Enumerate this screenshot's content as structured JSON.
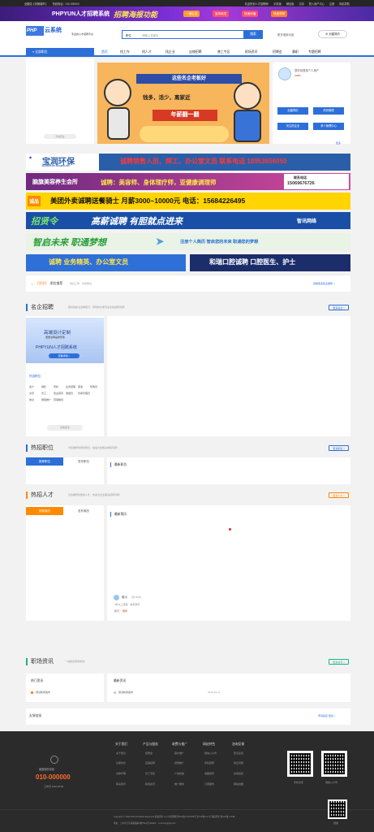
{
  "topbar": {
    "location": "全国站【切换城市】",
    "phone": "热线电话：010-000000",
    "welcome": "欢迎来到人才招聘网!",
    "mobile": "手机版",
    "wechat": "微信版",
    "app_link": "订阅",
    "login": "登入用户中心",
    "register": "注册",
    "nav_link": "网站导航"
  },
  "banner": {
    "brand": "PHPYUN人才招聘系统",
    "headline": "招聘海报功能",
    "pill1": "一键生成",
    "pill2": "宣传转发",
    "pill3": "快速传播",
    "pill4": "快速求职"
  },
  "header": {
    "logo": "PHP",
    "logo_suffix": "云系统",
    "tagline": "专业的人才招聘平台",
    "search_category": "职位",
    "search_placeholder": "请输入关键字",
    "search_button": "搜索",
    "more_search": "更多搜索功能",
    "create_resume": "创建简历"
  },
  "nav": {
    "category_label": "全部职位",
    "items": [
      "首页",
      "找工作",
      "找人才",
      "找企业",
      "店铺招聘",
      "普工专区",
      "职场资讯",
      "招聘会",
      "兼职",
      "专题招聘"
    ]
  },
  "sidebar": {
    "page_label": "查看更多"
  },
  "cartoon": {
    "line1": "这些名企老板好",
    "line2": "钱多，活少，离家近",
    "line3": "年薪翻一翻"
  },
  "user": {
    "greeting": "您好!",
    "sub": "请登录个人用户",
    "name": "uoshi",
    "btn_create": "创建简历",
    "btn_jobs": "简历管理",
    "btn_company": "关注的企业",
    "btn_apply": "求人管理中心",
    "more": "更多"
  },
  "ads": [
    {
      "brand": "宝润环保",
      "brand_en": "BAORUN EP-TECHNOLOGY",
      "text": "诚聘销售人员、焊工、办公室文员 联系电话 18953656050"
    },
    {
      "brand": "脑旗美容养生会所",
      "text": "诚聘：美容师、身体理疗师，亚健康调理师",
      "contact": "联系电话",
      "phone": "15069676726"
    },
    {
      "brand": "诚品",
      "text": "美团外卖诚聘送餐骑士 月薪3000~10000元 电话：15684226495"
    },
    {
      "brand": "招贤令",
      "text": "高薪诚聘  有胆就点进来",
      "logo": "智讯网络"
    },
    {
      "brand": "智启未来 职通梦想",
      "text": "注册个人简历 智启您的未来 职通您的梦想"
    },
    {
      "left": "诚聘 业务精英、办公室文员",
      "right": "和瑞口腔诚聘 口腔医生、护士"
    }
  ],
  "notice": {
    "tag": "【资金】",
    "title": "职位推荐",
    "desc": "找好工作、访问职位",
    "more": "查看更多职业推荐 >"
  },
  "famous": {
    "title": "名企招聘",
    "sub": "更好的雇主选择我们，聘到的才能专业化的招聘问题!",
    "more": "更多名企 >",
    "promo_title": "高端设计定制",
    "promo_sub": "更能诠释品牌形象",
    "promo_brand": "PHPYUN人才招聘系统",
    "promo_btn": "查看详情 >",
    "hot_label": "热招职位",
    "tags": [
      "会计",
      "销售",
      "司机",
      "业务经理",
      "保洁",
      "导购员",
      "文员",
      "普工",
      "置业顾问",
      "收银员",
      "仓库管理员",
      "",
      "前台",
      "网络推广",
      "营销策划",
      ""
    ],
    "view_more": "查看更多"
  },
  "hotjobs": {
    "title": "热招职位",
    "sub": "为您推荐优质的职位，快速为您解决求职问题!",
    "more": "更多职位 >",
    "tab1": "推荐职位",
    "tab2": "发布职位",
    "latest": "最新职位"
  },
  "talent": {
    "title": "热招人才",
    "sub": "为您推荐优质的人才，快速为企业解决招聘问题!",
    "more": "更多人才 >",
    "tab1": "推荐简历",
    "tab2": "发布简历",
    "latest": "最新简历",
    "person_name": "哈小",
    "person_meta": "(男 25岁)",
    "person_detail": "3年以上经验 · 本科学历",
    "person_role": "期望：",
    "person_job": "服务"
  },
  "news": {
    "title": "职场资讯",
    "sub": "一站助您职场成功!",
    "more": "更多资讯 >",
    "hot": "热门资讯",
    "latest": "最新资讯",
    "hot_item": "测试新闻发布",
    "latest_item": "测试新闻发布",
    "date": "2019-10-13"
  },
  "links": {
    "title": "友情链接",
    "more": "申请链接 更多 >"
  },
  "footer": {
    "service_label": "客服服务热线",
    "phone": "010-000000",
    "hours": "工作日 9:00-18:00",
    "cols": [
      {
        "h": "关于我们",
        "items": [
          "关于我们",
          "注册协议",
          "法律声明",
          "联系我们"
        ]
      },
      {
        "h": "产品与服务",
        "items": [
          "招聘会",
          "店铺招聘",
          "普工专区",
          "职场资讯"
        ]
      },
      {
        "h": "收费与推广",
        "items": [
          "猎才推广",
          "招聘推广",
          "广告投放",
          "推广服务"
        ]
      },
      {
        "h": "网站特色",
        "items": [
          "微信公众号",
          "手机招聘",
          "地图搜索",
          "订阅服务"
        ]
      },
      {
        "h": "咨询反馈",
        "items": [
          "意见反馈",
          "常见问题",
          "友情链接",
          "网站地图"
        ]
      }
    ],
    "qr1": "手机浏览",
    "qr2": "微信公众号",
    "copyright": "Copyright © 2009-2014 All Rights Reserved 版权所有 以人才招聘网 鲁ICP备17047455号 沪ICP备xxxx号 版权所有 鲁ICP备 17048",
    "address": "地址：上海市江苏南路路路4楼701A室 EMAIL：xxxxxxxx@qq.com",
    "qr3": "微信"
  }
}
